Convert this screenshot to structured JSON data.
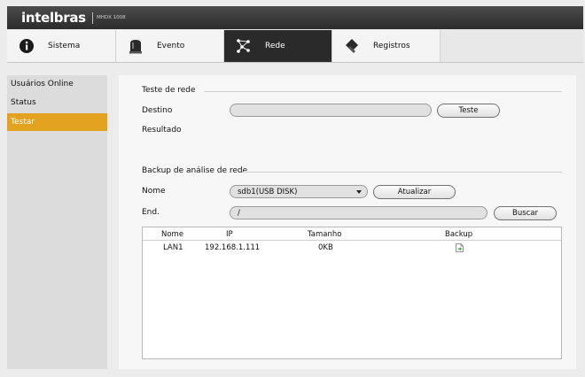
{
  "header": {
    "brand": "intelbras",
    "model": "MHDX 1008"
  },
  "tabs": [
    {
      "label": "Sistema",
      "icon": "info-icon",
      "active": false
    },
    {
      "label": "Evento",
      "icon": "alarm-icon",
      "active": false
    },
    {
      "label": "Rede",
      "icon": "network-icon",
      "active": true
    },
    {
      "label": "Registros",
      "icon": "log-icon",
      "active": false
    }
  ],
  "sidebar": {
    "items": [
      {
        "label": "Usuários Online",
        "active": false
      },
      {
        "label": "Status",
        "active": false
      },
      {
        "label": "Testar",
        "active": true
      }
    ]
  },
  "test": {
    "title": "Teste de rede",
    "destino_label": "Destino",
    "destino_value": "",
    "test_button": "Teste",
    "resultado_label": "Resultado",
    "resultado_value": ""
  },
  "backup": {
    "title": "Backup de análise de rede",
    "nome_label": "Nome",
    "device": "sdb1(USB DISK)",
    "update_button": "Atualizar",
    "end_label": "End.",
    "path": "/",
    "browse_button": "Buscar",
    "table": {
      "headers": [
        "Nome",
        "IP",
        "Tamanho",
        "Backup"
      ],
      "rows": [
        {
          "nome": "LAN1",
          "ip": "192.168.1.111",
          "tamanho": "0KB",
          "backup_icon": "file-export-icon"
        }
      ]
    }
  },
  "colors": {
    "accent": "#e3a31e",
    "active_tab": "#2a2a2a",
    "titlebar": "#3a3a3a"
  }
}
